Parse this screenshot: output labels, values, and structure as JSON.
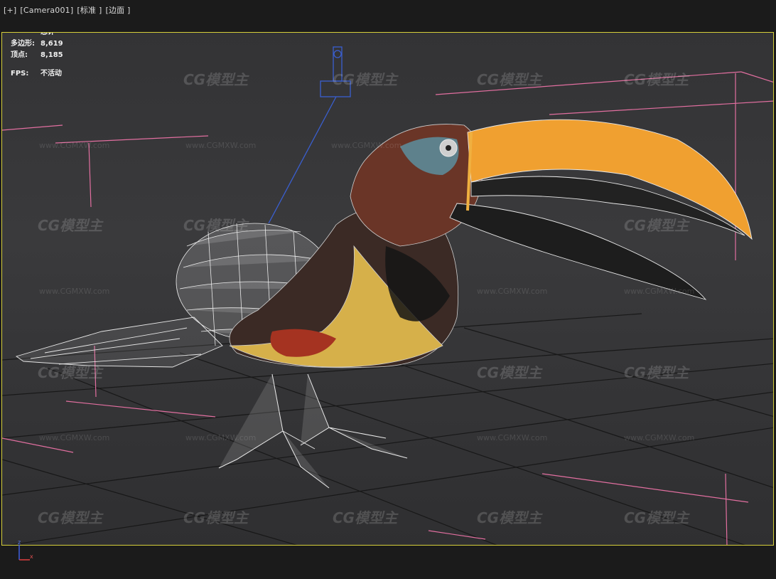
{
  "viewport": {
    "labels": [
      "[+]",
      "[Camera001]",
      "[标准 ]",
      "[边面 ]"
    ]
  },
  "stats": {
    "header": "总计",
    "polygons_label": "多边形:",
    "polygons_value": "8,619",
    "vertices_label": "顶点:",
    "vertices_value": "8,185",
    "fps_label": "FPS:",
    "fps_value": "不活动"
  },
  "watermark": {
    "logo_text": "CG模型主",
    "url_text": "www.CGMXW.com"
  },
  "gizmo": {
    "z_label": "z",
    "x_label": "x"
  },
  "colors": {
    "frame": "#d6cf3a",
    "grid": "#141414",
    "light_lines": "#e26fa0",
    "camera": "#3a5fd0",
    "beak": "#f0a030"
  }
}
